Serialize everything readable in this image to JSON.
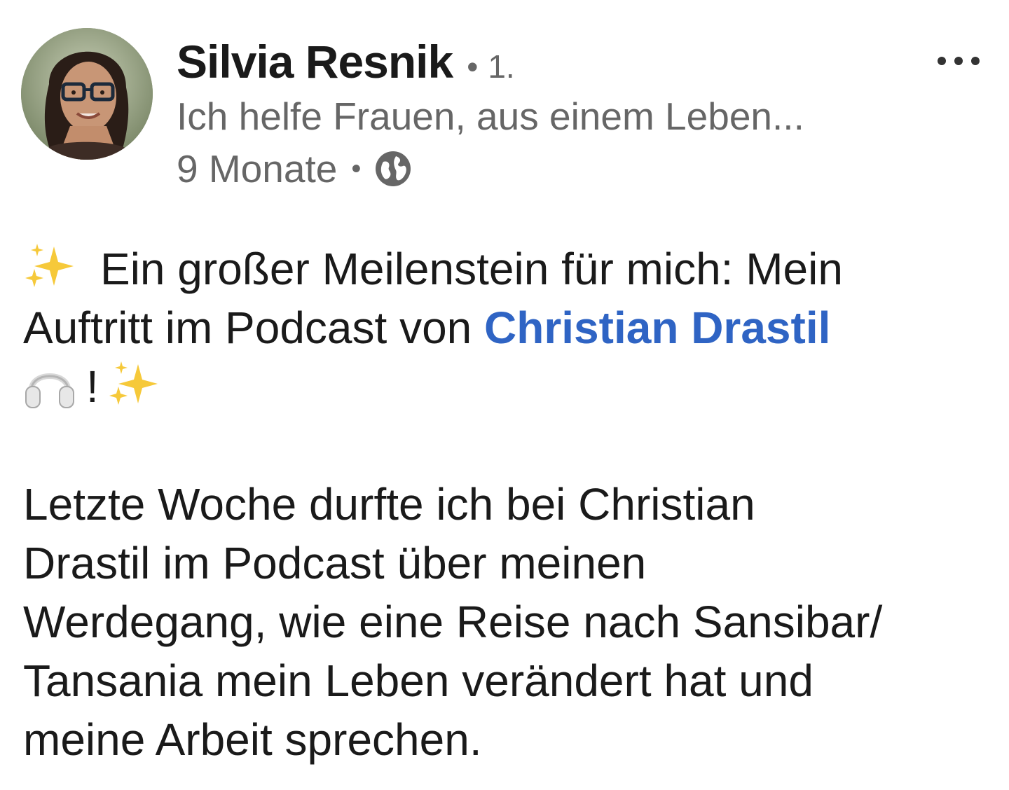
{
  "author": {
    "name": "Silvia Resnik",
    "separator": "•",
    "connection_degree": "1.",
    "headline": "Ich helfe Frauen, aus einem Leben...",
    "post_age": "9 Monate",
    "meta_separator": "•",
    "visibility_icon": "globe-icon",
    "avatar_icon": "profile-photo"
  },
  "more_icon": "more-horizontal-icon",
  "post": {
    "intro_line_1": "Ein großer Meilenstein für mich: Mein",
    "intro_line_2_prefix": "Auftritt im Podcast von",
    "mention": "Christian Drastil",
    "intro_line_3_suffix": "!",
    "body_lines": [
      "Letzte Woche durfte ich bei Christian",
      "Drastil im Podcast über meinen",
      "Werdegang, wie eine Reise nach Sansibar/",
      "Tansania mein Leben verändert hat und",
      "meine Arbeit sprechen."
    ]
  },
  "colors": {
    "mention": "#2f64c4",
    "secondary_text": "#666666",
    "primary_text": "#1a1a1a"
  }
}
